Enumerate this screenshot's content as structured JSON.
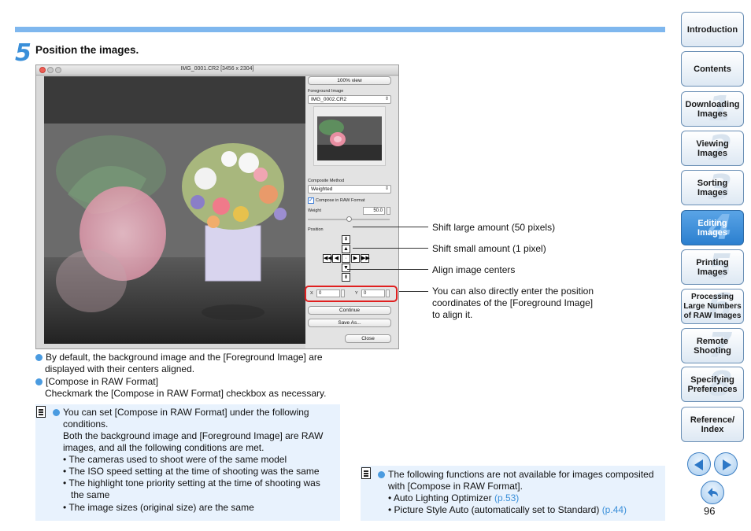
{
  "step": {
    "number": "5",
    "title": "Position the images."
  },
  "window": {
    "title": "IMG_0001.CR2 [3456 x 2304]",
    "btn_100": "100% view",
    "fg_label": "Foreground Image",
    "fg_value": "IMG_0002.CR2",
    "method_label": "Composite Method",
    "method_value": "Weighted",
    "compose_label": "Compose in RAW Format",
    "weight_label": "Weight",
    "weight_value": "50.0",
    "weight_fraction": 0.5,
    "position_label": "Position",
    "x_label": "X",
    "x_value": "0",
    "y_label": "Y",
    "y_value": "0",
    "continue": "Continue",
    "save_as": "Save As...",
    "close": "Close"
  },
  "callouts": {
    "large": "Shift large amount (50 pixels)",
    "small": "Shift small amount (1 pixel)",
    "center": "Align image centers",
    "direct_1": "You can also directly enter the position",
    "direct_2": "coordinates of the [Foreground Image]",
    "direct_3": "to align it."
  },
  "bullets": {
    "b1_1": "By default, the background image and the [Foreground Image] are",
    "b1_2": "displayed with their centers aligned.",
    "b2_1": "[Compose in RAW Format]",
    "b2_2": "Checkmark the [Compose in RAW Format] checkbox as necessary."
  },
  "note1": {
    "l1": "You can set [Compose in RAW Format] under the following",
    "l2": "conditions.",
    "l3": "Both the background image and [Foreground Image] are RAW",
    "l4": "images, and all the following conditions are met.",
    "i1": "The cameras used to shoot were of the same model",
    "i2": "The ISO speed setting at the time of shooting was the same",
    "i3a": "The highlight tone priority setting at the time of shooting was",
    "i3b": "the same",
    "i4": "The image sizes (original size) are the same"
  },
  "note2": {
    "l1": "The following functions are not available for images composited",
    "l2": "with [Compose in RAW Format].",
    "i1": "Auto Lighting Optimizer",
    "i1_link": "(p.53)",
    "i2": "Picture Style Auto (automatically set to Standard)",
    "i2_link": "(p.44)"
  },
  "sidebar": [
    {
      "label": "Introduction",
      "num": ""
    },
    {
      "label": "Contents",
      "num": ""
    },
    {
      "label": "Downloading Images",
      "num": "1"
    },
    {
      "label": "Viewing Images",
      "num": "2"
    },
    {
      "label": "Sorting Images",
      "num": "3"
    },
    {
      "label": "Editing Images",
      "num": "4"
    },
    {
      "label": "Printing Images",
      "num": "5"
    },
    {
      "label": "Processing Large Numbers of RAW Images",
      "num": "6"
    },
    {
      "label": "Remote Shooting",
      "num": "7"
    },
    {
      "label": "Specifying Preferences",
      "num": "8"
    },
    {
      "label": "Reference/ Index",
      "num": ""
    }
  ],
  "page_number": "96",
  "colors": {
    "accent": "#3a8fd9",
    "highlight": "#e02020",
    "note_bg": "#e8f2fd"
  }
}
